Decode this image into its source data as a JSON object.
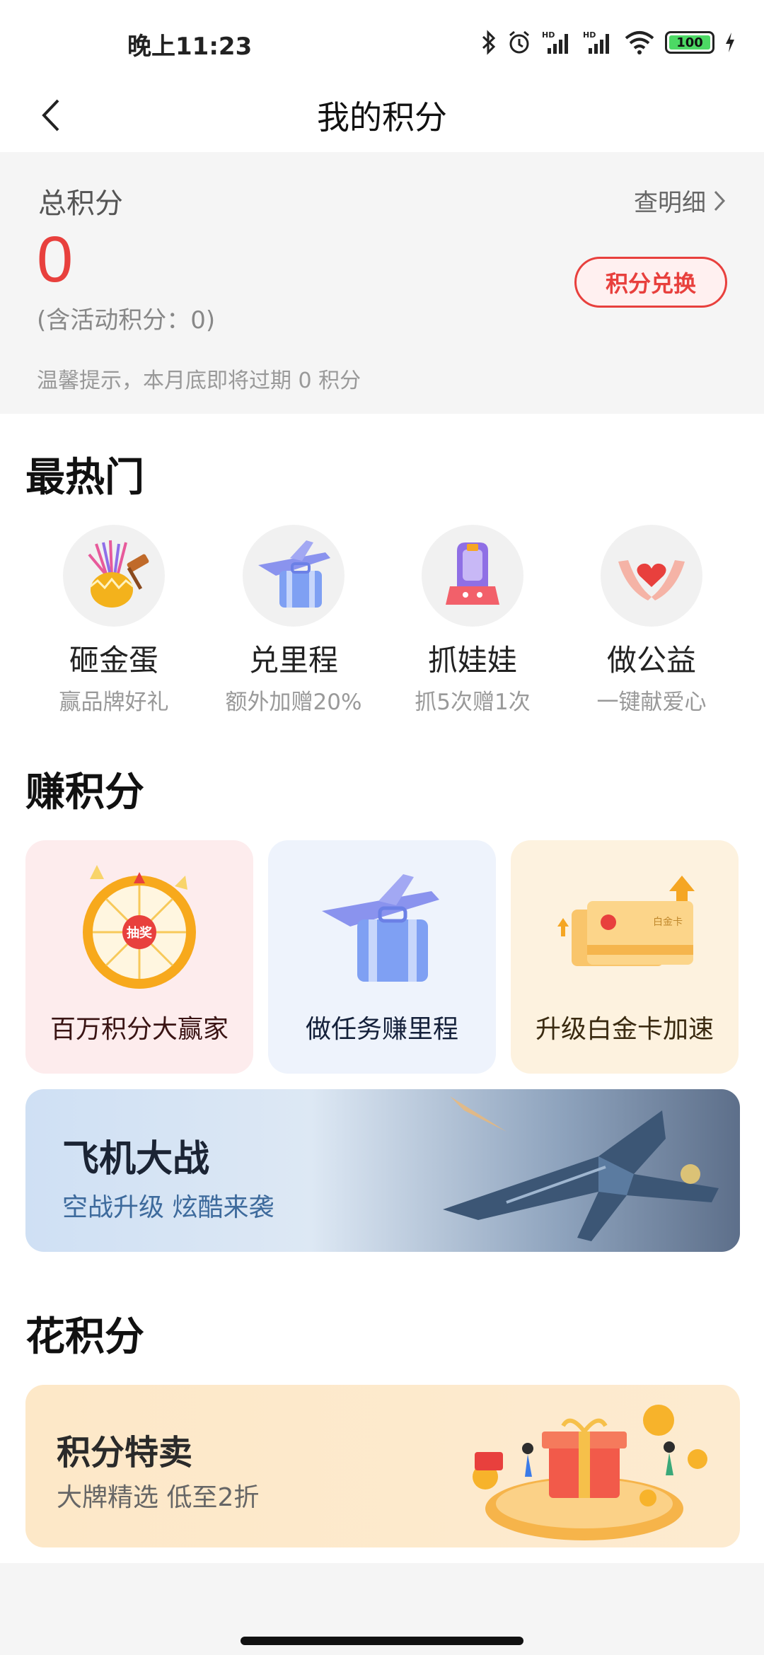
{
  "status_bar": {
    "time": "晚上11:23",
    "battery": "100",
    "icons": [
      "bluetooth-icon",
      "alarm-icon",
      "hd-signal-icon",
      "hd-signal-icon",
      "wifi-icon",
      "battery-icon",
      "charging-icon"
    ]
  },
  "nav": {
    "title": "我的积分",
    "back_icon": "chevron-left-icon"
  },
  "summary": {
    "label": "总积分",
    "detail_link": "查明细",
    "points": "0",
    "activity_points": "(含活动积分：0)",
    "exchange_button": "积分兑换",
    "tip": "温馨提示，本月底即将过期 0 积分",
    "accent_color": "#e8403d"
  },
  "hot": {
    "title": "最热门",
    "items": [
      {
        "name": "砸金蛋",
        "sub": "赢品牌好礼",
        "icon": "golden-egg-icon"
      },
      {
        "name": "兑里程",
        "sub": "额外加赠20%",
        "icon": "plane-luggage-icon"
      },
      {
        "name": "抓娃娃",
        "sub": "抓5次赠1次",
        "icon": "claw-machine-icon"
      },
      {
        "name": "做公益",
        "sub": "一键献爱心",
        "icon": "heart-hands-icon"
      }
    ]
  },
  "earn": {
    "title": "赚积分",
    "cards": [
      {
        "label": "百万积分大赢家",
        "icon": "prize-wheel-icon",
        "art_text": "抽奖",
        "bg": "#fdeced",
        "color": "#3a1414"
      },
      {
        "label": "做任务赚里程",
        "icon": "plane-luggage-icon",
        "bg": "#eef3fc",
        "color": "#14203a"
      },
      {
        "label": "升级白金卡加速",
        "icon": "upgrade-card-icon",
        "art_text": "白金卡",
        "bg": "#fdf2df",
        "color": "#3a2a10"
      }
    ]
  },
  "plane_banner": {
    "title": "飞机大战",
    "sub": "空战升级  炫酷来袭",
    "icon": "fighter-jet-icon"
  },
  "spend": {
    "title": "花积分",
    "banner_title": "积分特卖",
    "banner_sub": "大牌精选  低至2折",
    "icon": "gift-coins-icon"
  }
}
